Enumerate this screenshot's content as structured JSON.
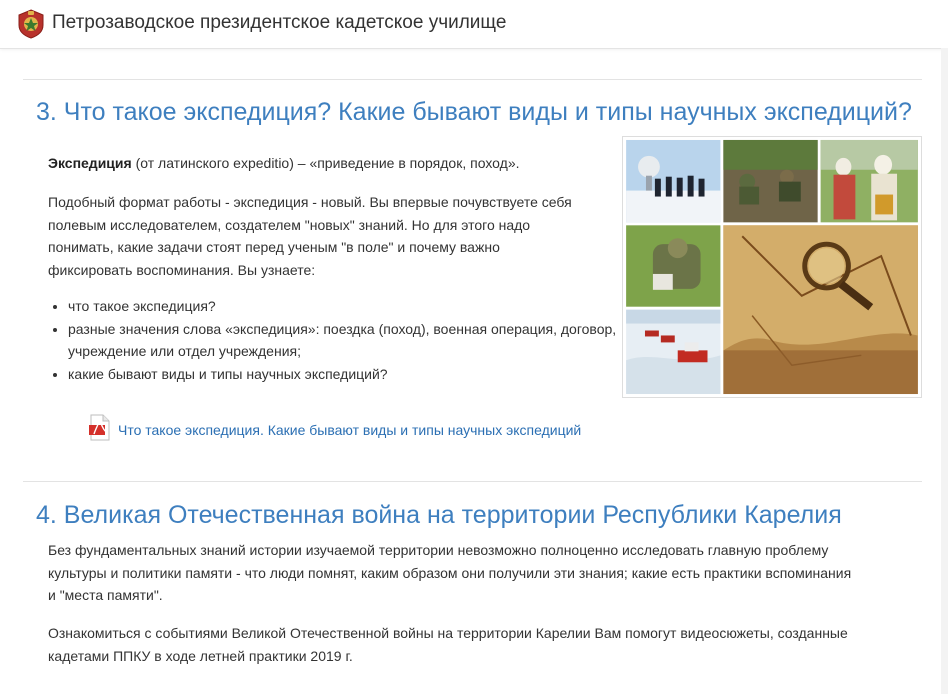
{
  "header": {
    "site_title": "Петрозаводское президентское кадетское училище",
    "logo_icon": "emblem-icon"
  },
  "section3": {
    "title": "3. Что такое экспедиция? Какие бывают виды и типы научных экспедиций?",
    "definition_term": "Экспедиция",
    "definition_rest": " (от латинского expeditio) – «приведение в порядок, поход».",
    "paragraph_lines": [
      "Подобный формат работы - экспедиция - новый. Вы впервые почувствуете себя",
      "полевым исследователем, создателем \"новых\" знаний. Но для этого надо",
      "понимать, какие задачи стоят перед ученым \"в поле\" и почему важно",
      "фиксировать воспоминания. Вы узнаете:"
    ],
    "bullets": [
      "что такое экспедиция?",
      "разные значения слова «экспедиция»: поездка (поход), военная операция, договор, учреждение или отдел учреждения;",
      "какие бывают виды и типы научных экспедиций?"
    ],
    "pdf_link": "Что такое экспедиция. Какие бывают виды и типы научных экспедиций"
  },
  "section4": {
    "title": "4. Великая Отечественная война на территории Республики Карелия",
    "paragraph1_lines": [
      "Без фундаментальных знаний истории изучаемой территории невозможно полноценно исследовать главную проблему",
      "культуры и политики памяти - что люди помнят, каким образом они получили эти знания; какие есть практики вспоминания",
      "и \"места памяти\"."
    ],
    "paragraph2_lines": [
      "Ознакомиться с событиями Великой Отечественной войны на территории Карелии Вам помогут видеосюжеты, созданные",
      "кадетами ППКУ в ходе летней практики 2019 г."
    ]
  },
  "colors": {
    "heading": "#3e7fbf",
    "link": "#2b6fb3",
    "text": "#333333",
    "rule": "#e3e3e3"
  }
}
